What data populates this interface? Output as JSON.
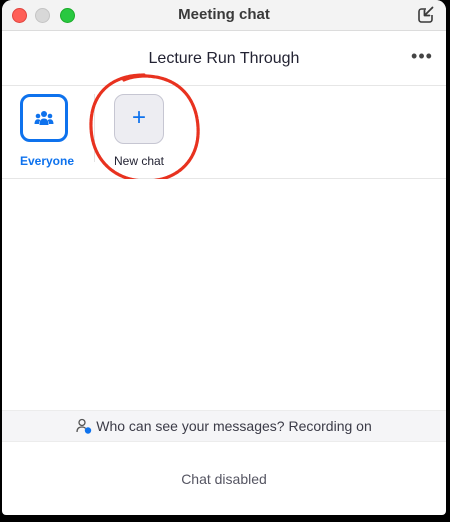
{
  "window": {
    "title": "Meeting chat"
  },
  "header": {
    "meeting_name": "Lecture Run Through",
    "more_label": "•••"
  },
  "recipients": {
    "everyone_label": "Everyone",
    "new_chat_plus": "+",
    "new_chat_label": "New chat"
  },
  "notice": {
    "text": "Who can see your messages? Recording on"
  },
  "footer": {
    "status": "Chat disabled"
  },
  "colors": {
    "accent": "#0e72ed",
    "annotation": "#e8321f",
    "close": "#ff5f57",
    "maximize": "#28c840"
  },
  "icons": {
    "everyone": "people-group-icon",
    "new_chat": "plus-icon",
    "popin": "pop-in-icon",
    "notice": "person-info-icon"
  }
}
